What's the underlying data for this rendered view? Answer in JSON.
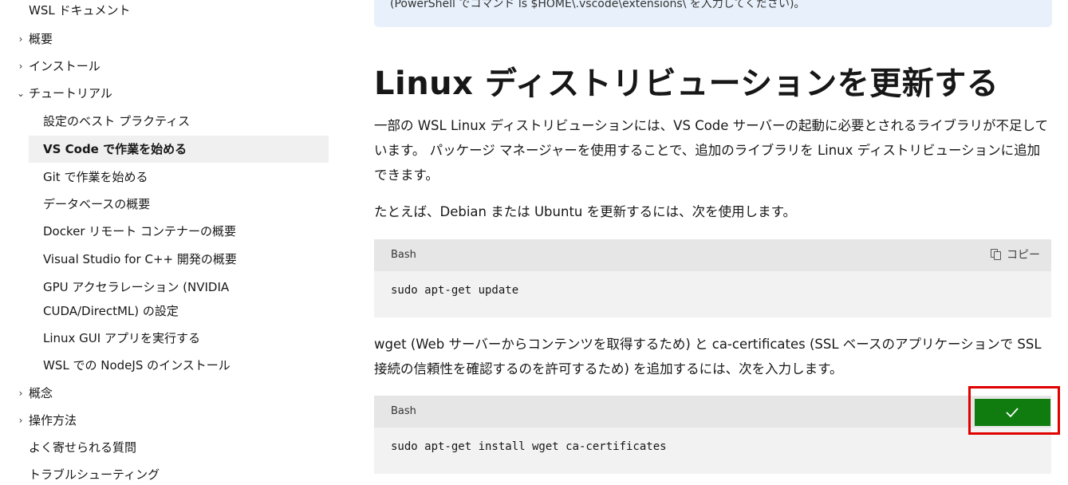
{
  "sidebar": {
    "items": [
      {
        "label": "WSL ドキュメント",
        "chevron": ""
      },
      {
        "label": "概要",
        "chevron": "›"
      },
      {
        "label": "インストール",
        "chevron": "›"
      },
      {
        "label": "チュートリアル",
        "chevron": "⌄"
      },
      {
        "label": "設定のベスト プラクティス",
        "chevron": ""
      },
      {
        "label": "VS Code で作業を始める",
        "chevron": ""
      },
      {
        "label": "Git で作業を始める",
        "chevron": ""
      },
      {
        "label": "データベースの概要",
        "chevron": ""
      },
      {
        "label": "Docker リモート コンテナーの概要",
        "chevron": ""
      },
      {
        "label": "Visual Studio for C++ 開発の概要",
        "chevron": ""
      },
      {
        "label": "GPU アクセラレーション (NVIDIA CUDA/DirectML) の設定",
        "chevron": ""
      },
      {
        "label": "Linux GUI アプリを実行する",
        "chevron": ""
      },
      {
        "label": "WSL での NodeJS のインストール",
        "chevron": ""
      },
      {
        "label": "概念",
        "chevron": "›"
      },
      {
        "label": "操作方法",
        "chevron": "›"
      },
      {
        "label": "よく寄せられる質問",
        "chevron": ""
      },
      {
        "label": "トラブルシューティング",
        "chevron": ""
      }
    ]
  },
  "main": {
    "note_text": "(PowerShell でコマンド ls $HOME\\.vscode\\extensions\\ を入力してください)。",
    "heading": "Linux ディストリビューションを更新する",
    "para1": "一部の WSL Linux ディストリビューションには、VS Code サーバーの起動に必要とされるライブラリが不足しています。 パッケージ マネージャーを使用することで、追加のライブラリを Linux ディストリビューションに追加できます。",
    "para2": "たとえば、Debian または Ubuntu を更新するには、次を使用します。",
    "code1": {
      "lang": "Bash",
      "copy_label": "コピー",
      "code": "sudo apt-get update"
    },
    "para3": "wget (Web サーバーからコンテンツを取得するため) と ca-certificates (SSL ベースのアプリケーションで SSL 接続の信頼性を確認するのを許可するため) を追加するには、次を入力します。",
    "code2": {
      "lang": "Bash",
      "code": "sudo apt-get install wget ca-certificates"
    }
  },
  "colors": {
    "copied_green": "#107c10",
    "highlight_red": "#e00000",
    "code_bg": "#f2f2f2",
    "note_bg": "#e8f1fb"
  },
  "icons": {
    "copy": "copy-icon",
    "check": "checkmark-icon",
    "chevron_right": "chevron-right-icon",
    "chevron_down": "chevron-down-icon"
  }
}
